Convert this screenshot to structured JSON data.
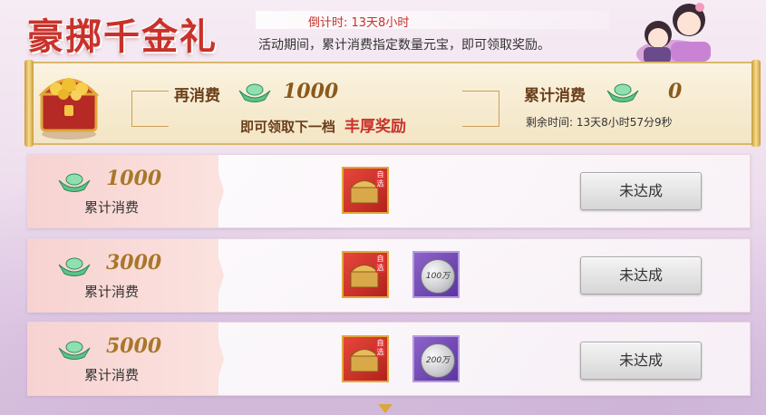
{
  "header": {
    "title": "豪掷千金礼",
    "countdown": "倒计时: 13天8小时",
    "description": "活动期间，累计消费指定数量元宝，即可领取奖励。"
  },
  "banner": {
    "spend_more_label": "再消费",
    "spend_more_value": "1000",
    "next_tier_text": "即可领取下一档",
    "reward_highlight": "丰厚奖励",
    "total_spent_label": "累计消费",
    "total_spent_value": "0",
    "remaining_time": "剩余时间: 13天8小时57分9秒"
  },
  "tiers": [
    {
      "amount": "1000",
      "label": "累计消费",
      "chest_tag": "自选",
      "coin_text": "",
      "button": "未达成"
    },
    {
      "amount": "3000",
      "label": "累计消费",
      "chest_tag": "自选",
      "coin_text": "100万",
      "button": "未达成"
    },
    {
      "amount": "5000",
      "label": "累计消费",
      "chest_tag": "自选",
      "coin_text": "200万",
      "button": "未达成"
    }
  ],
  "icons": {
    "currency": "silver-ingot-icon",
    "chest": "treasure-chest-icon",
    "coin": "silver-coin-icon",
    "scroll": "chevron-down-icon"
  },
  "colors": {
    "title_red": "#c8322a",
    "gold": "#d9b96a",
    "tier_tab_pink": "#f7d2d0",
    "coin_purple": "#7a50b8"
  }
}
